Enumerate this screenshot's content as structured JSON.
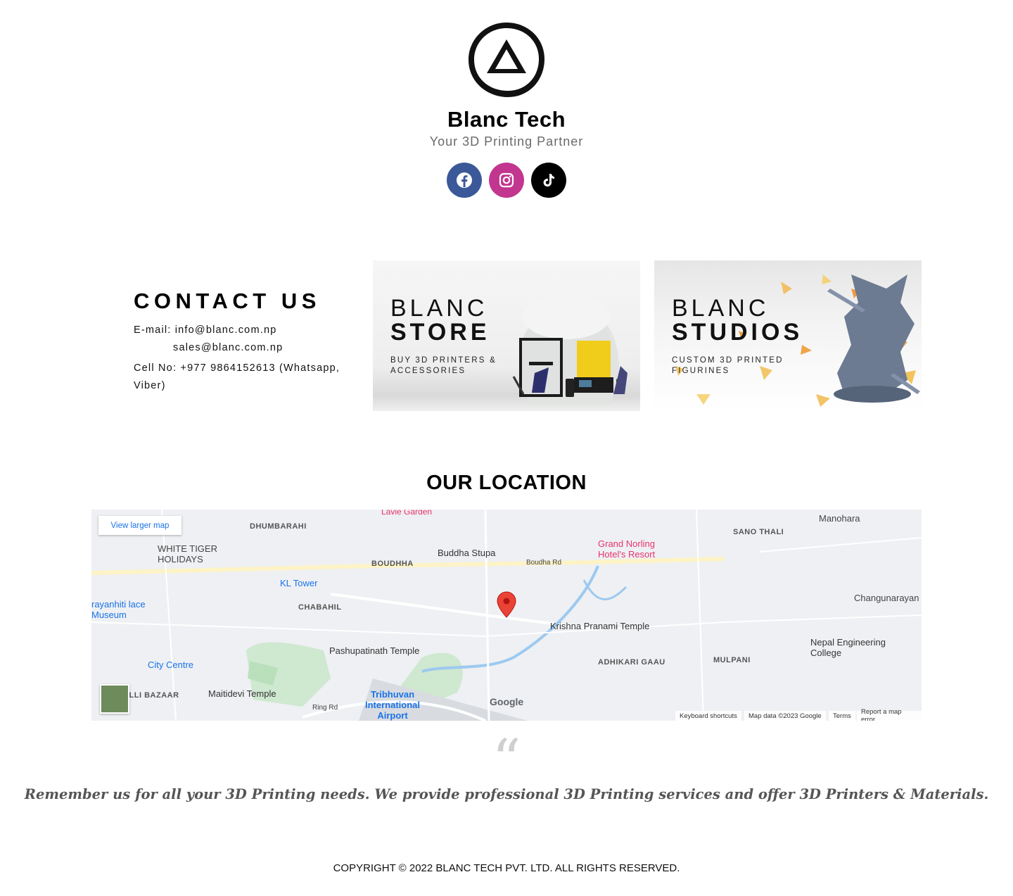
{
  "header": {
    "brand": "Blanc Tech",
    "tagline": "Your 3D Printing Partner",
    "social": [
      {
        "name": "facebook",
        "icon": "facebook-icon",
        "color": "#3b5998"
      },
      {
        "name": "instagram",
        "icon": "instagram-icon",
        "color": "#c2368f"
      },
      {
        "name": "tiktok",
        "icon": "tiktok-icon",
        "color": "#000000"
      }
    ]
  },
  "contact": {
    "title": "CONTACT US",
    "email_line_1": "E-mail: info@blanc.com.np",
    "email_line_2": "sales@blanc.com.np",
    "cell": "Cell No: +977 9864152613 (Whatsapp, Viber)"
  },
  "cards": {
    "store": {
      "word1": "BLANC",
      "word2": "STORE",
      "subtitle": "BUY 3D PRINTERS & ACCESSORIES"
    },
    "studios": {
      "word1": "BLANC",
      "word2": "STUDIOS",
      "subtitle": "CUSTOM 3D PRINTED FIGURINES"
    }
  },
  "location": {
    "title": "OUR LOCATION",
    "map_button": "View larger map",
    "labels": {
      "buddha_stupa": "Buddha Stupa",
      "boudha": "BOUDHHA",
      "chabahil": "CHABAHIL",
      "kl_tower": "KL Tower",
      "pashupatinath": "Pashupatinath Temple",
      "krishna_pranami": "Krishna Pranami Temple",
      "grand_norling": "Grand Norling Hotel's Resort",
      "tribhuvan": "Tribhuvan International Airport",
      "adhikari_gaau": "ADHIKARI GAAU",
      "sano_thali": "SANO THALI",
      "manohara": "Manohara",
      "changunarayan": "Changunarayan",
      "nepal_engineering": "Nepal Engineering College",
      "maitidevi": "Maitidevi Temple",
      "city_centre": "City Centre",
      "white_tiger": "WHITE TIGER HOLIDAYS",
      "dhumbarahi": "DHUMBARAHI",
      "mulpani": "MULPANI",
      "boudha_rd": "Boudha Rd",
      "ring_rd": "Ring Rd",
      "lavie_garden": "Lavie Garden",
      "palace_museum": "rayanhiti lace Museum",
      "dilli_bazaar": "ILLI BAZAAR"
    },
    "footer": {
      "shortcuts": "Keyboard shortcuts",
      "mapdata": "Map data ©2023 Google",
      "terms": "Terms",
      "report": "Report a map error",
      "google": "Google"
    }
  },
  "quote": {
    "mark": "“",
    "text": "Remember us for all your 3D Printing needs. We provide professional 3D Printing services and offer 3D Printers & Materials."
  },
  "footer": {
    "copyright": "COPYRIGHT © 2022 BLANC TECH PVT. LTD. ALL RIGHTS RESERVED."
  }
}
